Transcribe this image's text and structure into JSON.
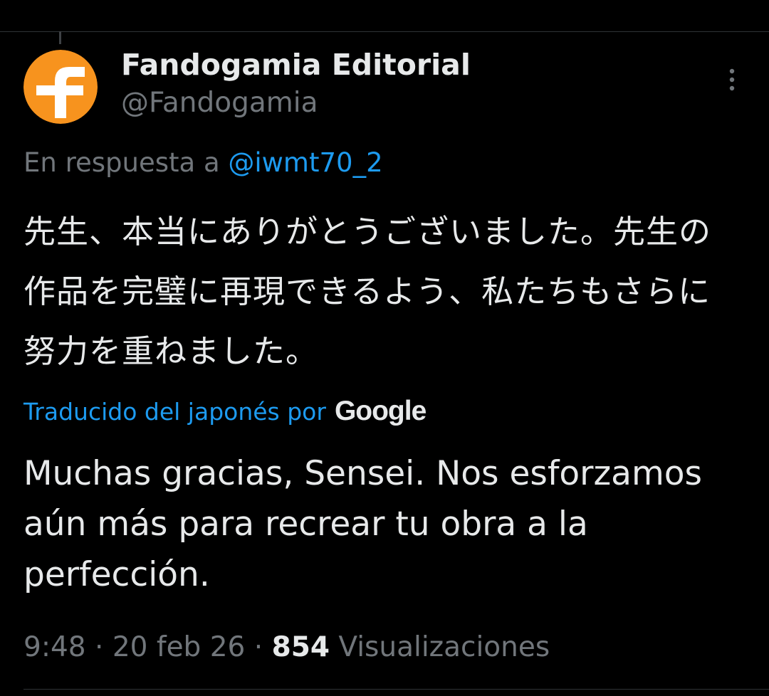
{
  "author": {
    "display_name": "Fandogamia Editorial",
    "handle": "@Fandogamia",
    "avatar_letter": "f",
    "avatar_color": "#f7931e"
  },
  "reply": {
    "prefix": "En respuesta a",
    "mention": "@iwmt70_2"
  },
  "tweet": {
    "text": "先生、本当にありがとうございました。先生の作品を完璧に再現できるよう、私たちもさらに努力を重ねました。"
  },
  "translation": {
    "source_label": "Traducido del japonés por",
    "provider": "Google",
    "text": "Muchas gracias, Sensei. Nos esforzamos aún más para recrear tu obra a la perfección."
  },
  "meta": {
    "time": "9:48",
    "separator": "·",
    "date": "20 feb 26",
    "views_count": "854",
    "views_label": "Visualizaciones"
  },
  "icons": {
    "more": "more-vertical-icon"
  },
  "colors": {
    "background": "#000000",
    "text_primary": "#e7e9ea",
    "text_secondary": "#71767b",
    "link": "#1d9bf0",
    "divider": "#2f3336"
  }
}
